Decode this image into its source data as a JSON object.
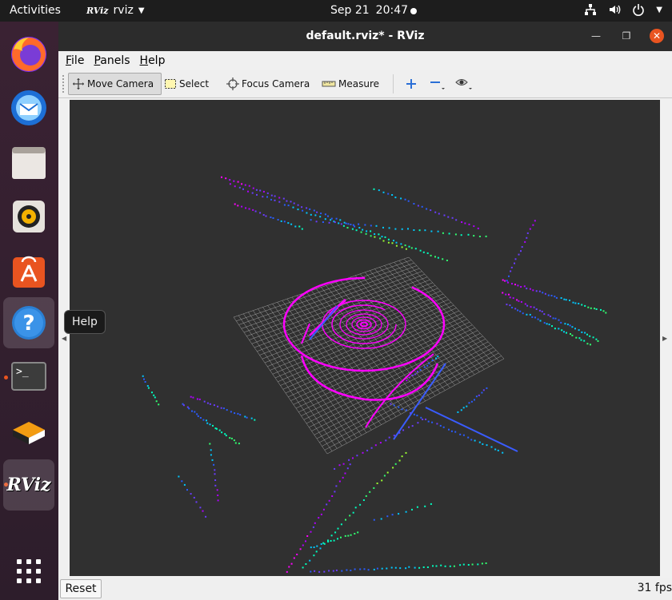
{
  "topbar": {
    "activities": "Activities",
    "app_logo_text": "RViz",
    "app_name": "rviz",
    "date": "Sep 21",
    "time": "20:47"
  },
  "dock": {
    "items": [
      {
        "name": "firefox",
        "icon": "firefox-icon"
      },
      {
        "name": "thunderbird",
        "icon": "thunderbird-icon"
      },
      {
        "name": "files",
        "icon": "files-icon"
      },
      {
        "name": "rhythmbox",
        "icon": "rhythmbox-icon"
      },
      {
        "name": "software",
        "icon": "software-icon"
      },
      {
        "name": "help",
        "icon": "help-icon"
      },
      {
        "name": "terminal",
        "icon": "terminal-icon",
        "text": ">_"
      },
      {
        "name": "ros-tools",
        "icon": "stack-icon"
      },
      {
        "name": "rviz",
        "icon": "rviz-icon",
        "text": "RViz"
      },
      {
        "name": "show-apps",
        "icon": "grid-icon"
      }
    ],
    "tooltip": "Help"
  },
  "window": {
    "title": "default.rviz* - RViz",
    "menu": {
      "file_hot": "F",
      "file_rest": "ile",
      "panels_hot": "P",
      "panels_rest": "anels",
      "help_hot": "H",
      "help_rest": "elp"
    },
    "toolbar": {
      "move_camera": "Move Camera",
      "select": "Select",
      "focus_camera": "Focus Camera",
      "measure": "Measure"
    },
    "status": {
      "reset": "Reset",
      "fps": "31 fps"
    }
  },
  "colors": {
    "accent": "#e95420",
    "viewport_bg": "#303030",
    "grid": "#c8c8c8",
    "scan_magenta": "#ff00ff"
  }
}
